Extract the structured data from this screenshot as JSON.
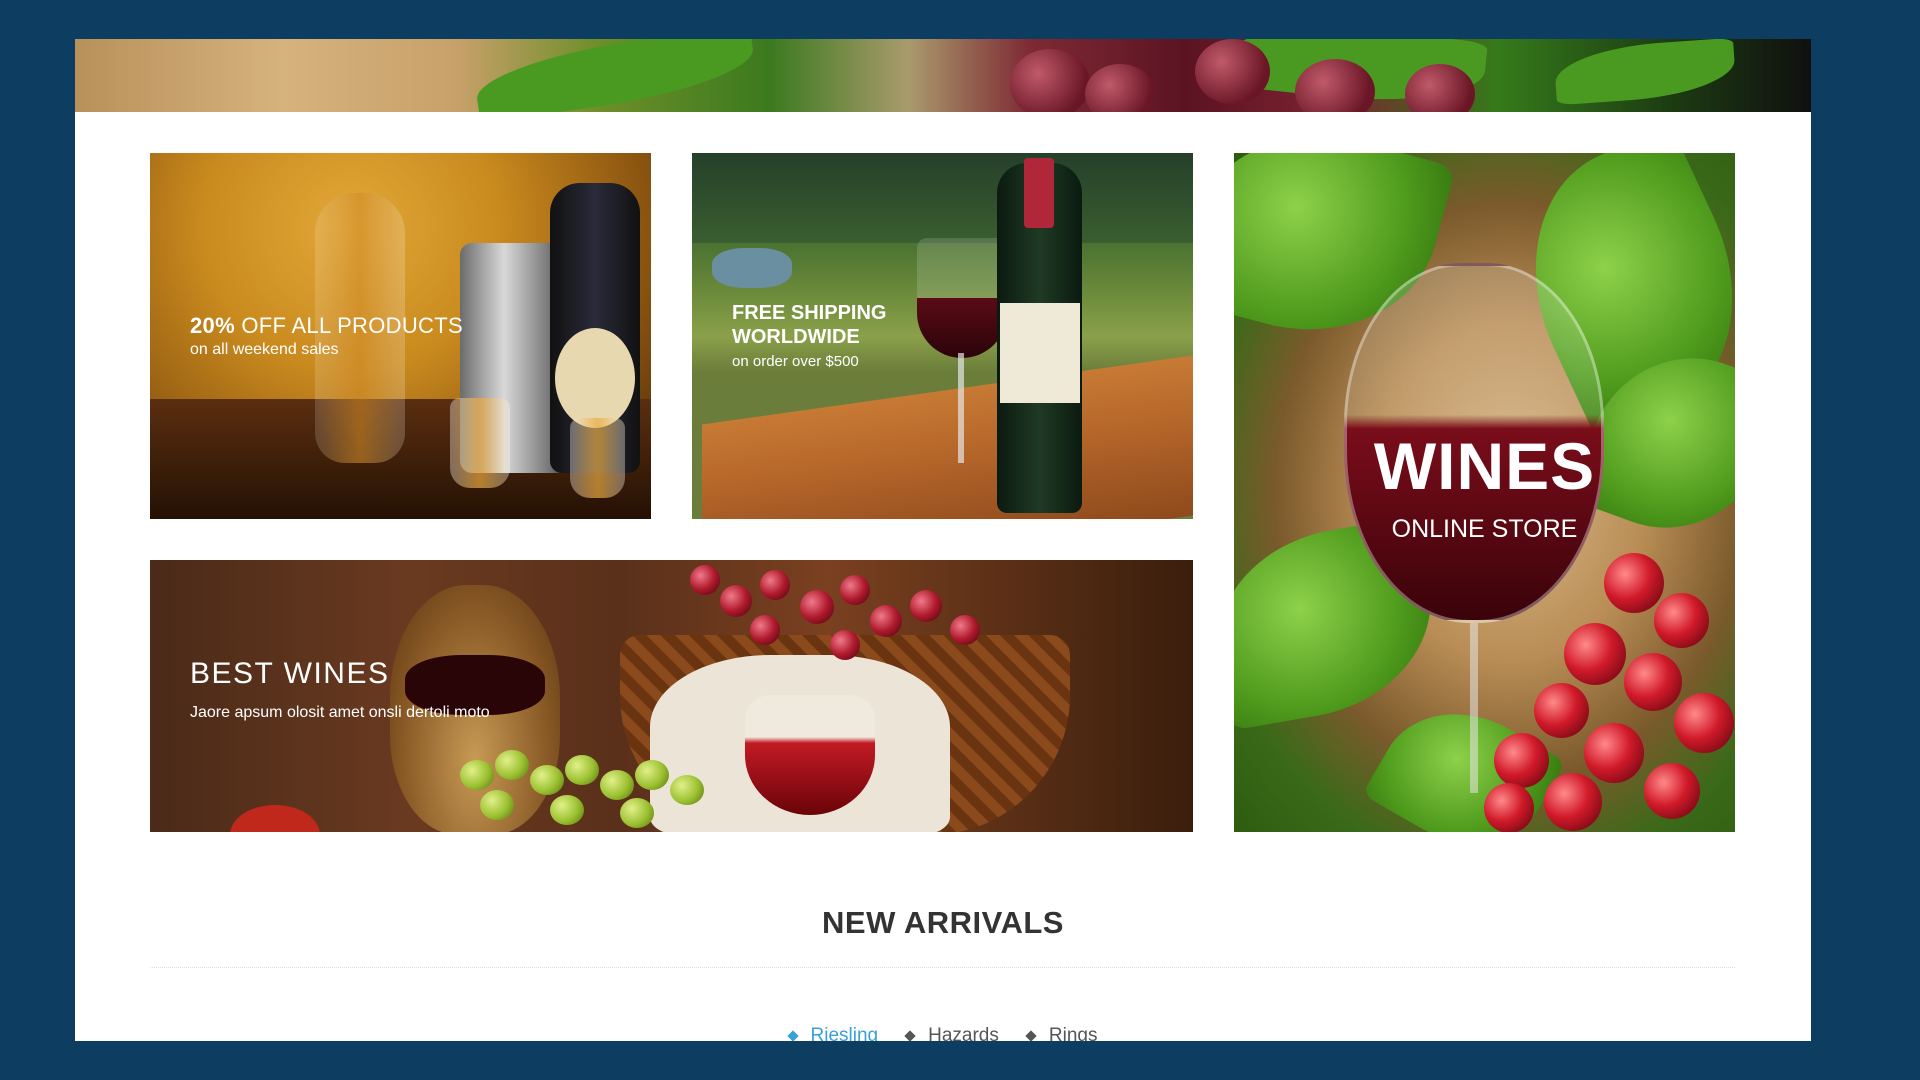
{
  "banners": {
    "promo": {
      "discount": "20%",
      "headline_rest": "OFF ALL PRODUCTS",
      "subline": "on all weekend sales"
    },
    "shipping": {
      "headline_1": "FREE SHIPPING",
      "headline_2": "WORLDWIDE",
      "subline": "on order over $500"
    },
    "store": {
      "title": "WINES",
      "subtitle": "ONLINE STORE"
    },
    "best": {
      "title": "BEST WINES",
      "description": "Jaore apsum olosit amet onsli dertoli moto"
    }
  },
  "new_arrivals": {
    "title": "NEW ARRIVALS",
    "tabs": [
      {
        "label": "Riesling",
        "active": true
      },
      {
        "label": "Hazards",
        "active": false
      },
      {
        "label": "Rings",
        "active": false
      }
    ]
  },
  "colors": {
    "frame_bg": "#0d3d60",
    "accent": "#3aa0d9",
    "heading": "#333333"
  },
  "icons": {
    "tab_bullet": "diamond-icon"
  }
}
